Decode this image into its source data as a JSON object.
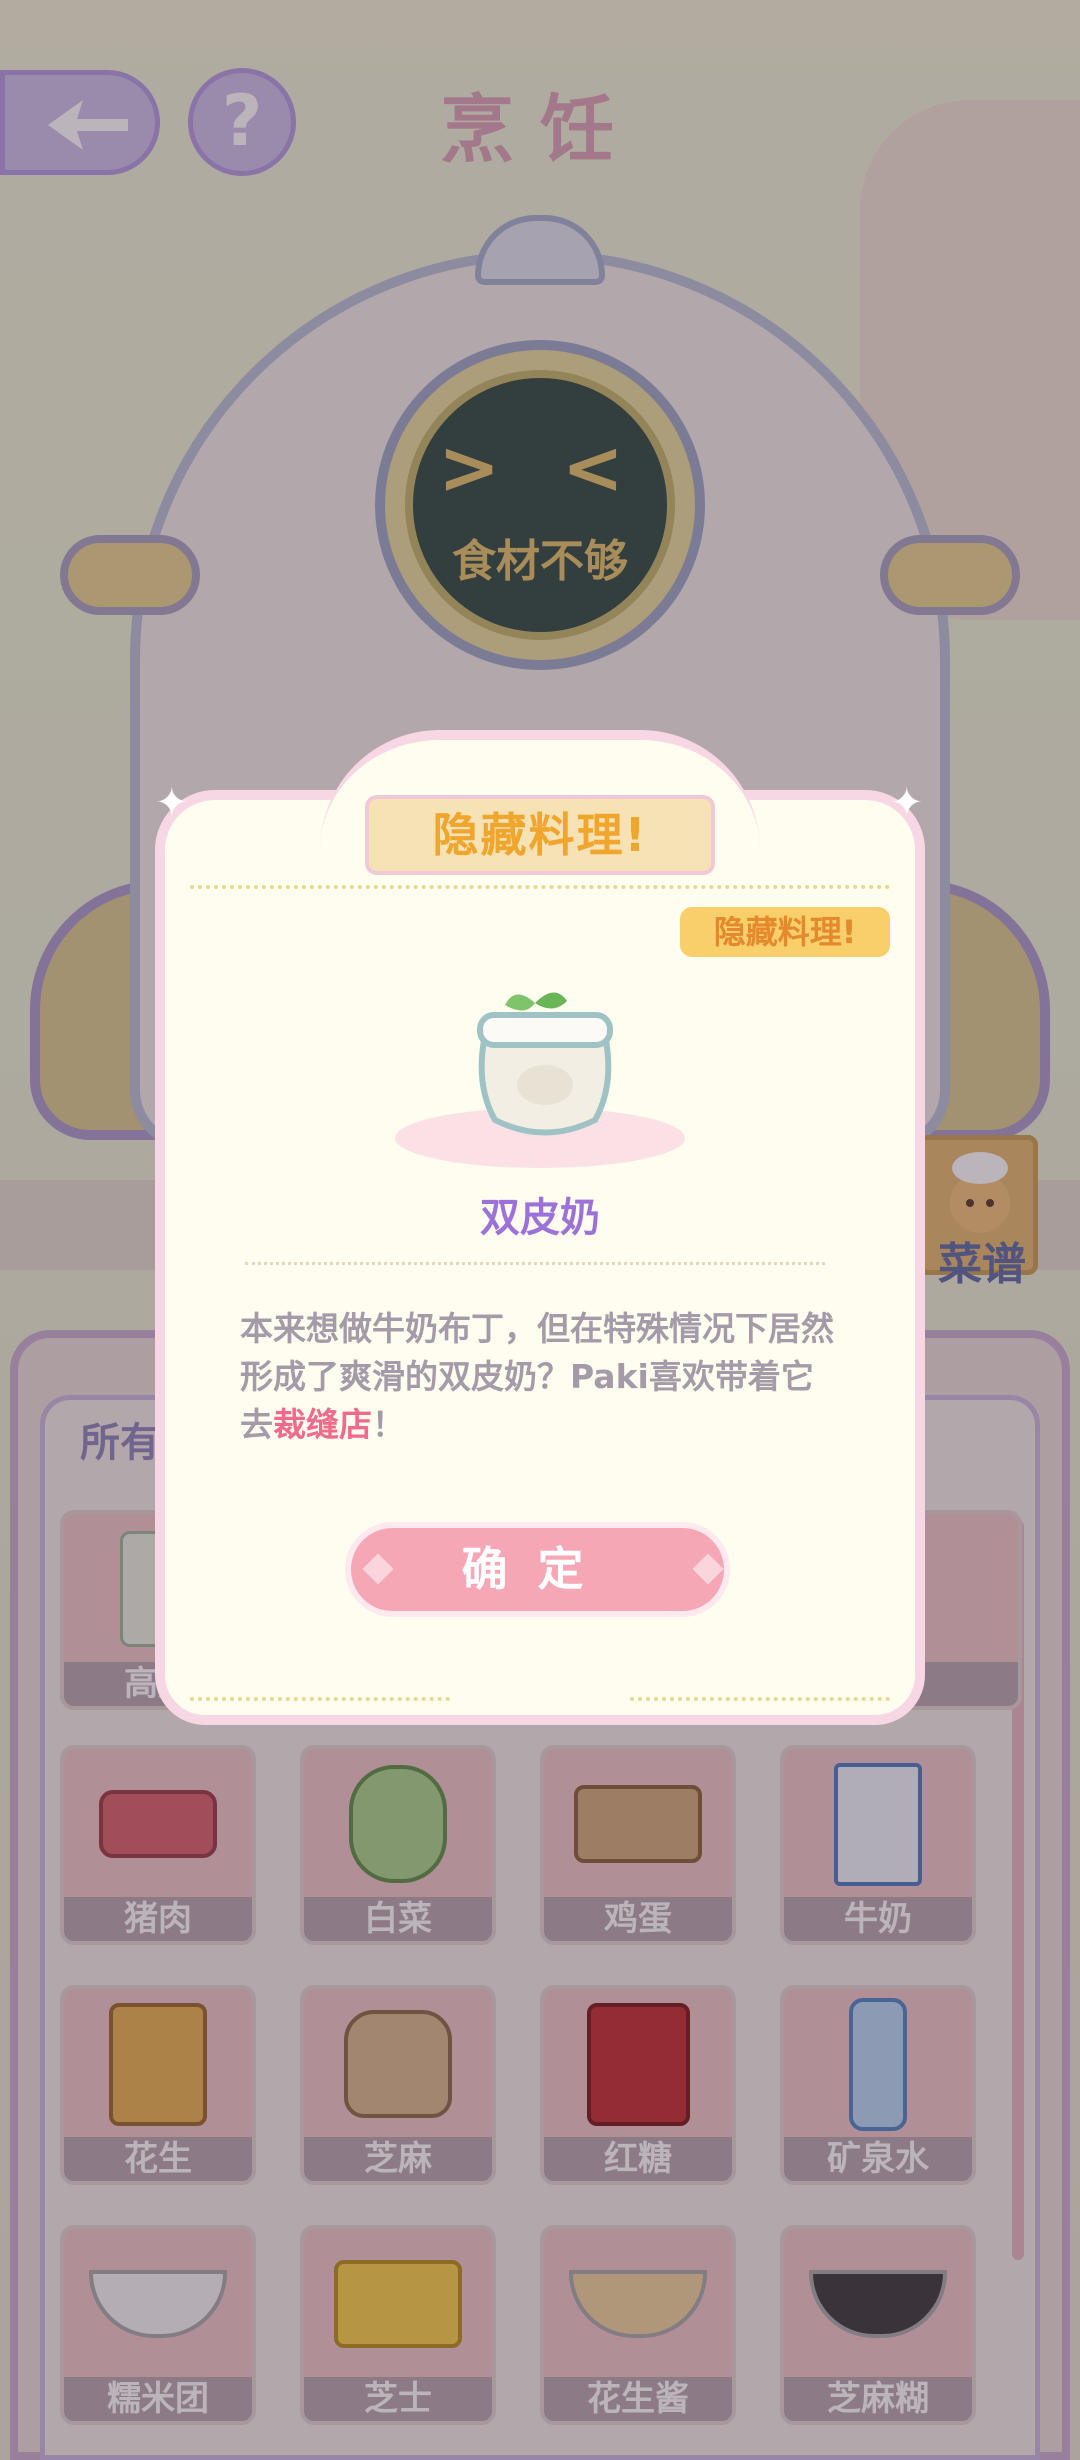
{
  "header": {
    "title": "烹饪"
  },
  "pot": {
    "face": "> <",
    "status": "食材不够"
  },
  "recipe_tab": {
    "label": "菜谱"
  },
  "panel": {
    "tab_label": "所有",
    "items": [
      {
        "name": "高筋"
      },
      {
        "name": "猪肉"
      },
      {
        "name": "白菜"
      },
      {
        "name": "鸡蛋"
      },
      {
        "name": "牛奶"
      },
      {
        "name": "花生"
      },
      {
        "name": "芝麻"
      },
      {
        "name": "红糖"
      },
      {
        "name": "矿泉水"
      },
      {
        "name": "糯米团"
      },
      {
        "name": "芝士"
      },
      {
        "name": "花生酱"
      },
      {
        "name": "芝麻糊"
      }
    ]
  },
  "dialog": {
    "banner": "隐藏料理!",
    "tag": "隐藏料理!",
    "dish_name": "双皮奶",
    "desc_part1": "本来想做牛奶布丁，但在特殊情况下居然形成了爽滑的双皮奶？Paki喜欢带着它去",
    "desc_highlight": "裁缝店",
    "desc_part2": "！",
    "confirm_label": "确定"
  },
  "colors": {
    "accent_pink": "#f6a7b6",
    "highlight": "#f06a8e",
    "dish_name": "#9d72d8",
    "banner_text": "#f0a52c"
  }
}
